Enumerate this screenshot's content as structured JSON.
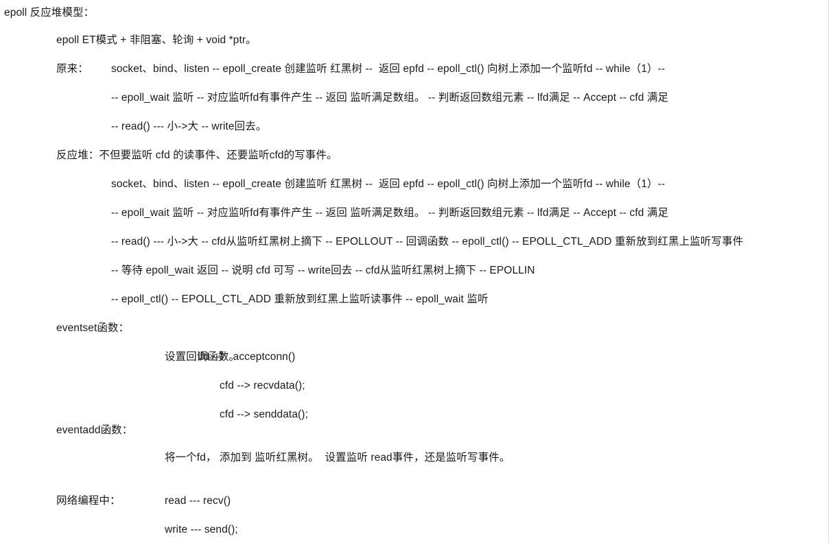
{
  "document": {
    "title": "epoll 反应堆模型：",
    "background_color": "#ffffff",
    "text_color": "#1a1a1a",
    "edge_rule_color": "#e3e3e3",
    "lines": {
      "title": "epoll 反应堆模型：",
      "et_mode": "epoll ET模式 + 非阻塞、轮询 + void *ptr。",
      "original_label": "原来：",
      "original_flow_1": "socket、bind、listen -- epoll_create 创建监听 红黑树 --  返回 epfd -- epoll_ctl() 向树上添加一个监听fd -- while（1）--",
      "original_flow_2": "-- epoll_wait 监听 -- 对应监听fd有事件产生 -- 返回 监听满足数组。 -- 判断返回数组元素 -- lfd满足 -- Accept -- cfd 满足",
      "original_flow_3": "-- read() --- 小->大 -- write回去。",
      "reactor_label": "反应堆：不但要监听 cfd 的读事件、还要监听cfd的写事件。",
      "reactor_flow_1": "socket、bind、listen -- epoll_create 创建监听 红黑树 --  返回 epfd -- epoll_ctl() 向树上添加一个监听fd -- while（1）--",
      "reactor_flow_2": "-- epoll_wait 监听 -- 对应监听fd有事件产生 -- 返回 监听满足数组。 -- 判断返回数组元素 -- lfd满足 -- Accept -- cfd 满足",
      "reactor_flow_3": "-- read() --- 小->大 -- cfd从监听红黑树上摘下 -- EPOLLOUT -- 回调函数 -- epoll_ctl() -- EPOLL_CTL_ADD 重新放到红黑上监听写事件",
      "reactor_flow_4": "-- 等待 epoll_wait 返回 -- 说明 cfd 可写 -- write回去 -- cfd从监听红黑树上摘下 -- EPOLLIN",
      "reactor_flow_5": "-- epoll_ctl() -- EPOLL_CTL_ADD 重新放到红黑上监听读事件 -- epoll_wait 监听",
      "eventset_label": "eventset函数：",
      "eventset_body_1": "设置回调函数。",
      "eventset_body_1b": "lfd --》 acceptconn()",
      "eventset_body_2": "cfd --> recvdata();",
      "eventset_body_3": "cfd --> senddata();",
      "eventadd_label": "eventadd函数：",
      "eventadd_body_1": "将一个fd， 添加到 监听红黑树。  设置监听 read事件，还是监听写事件。",
      "network_label": "网络编程中：",
      "network_body_1": "read --- recv()",
      "network_body_2": "write --- send();"
    }
  }
}
